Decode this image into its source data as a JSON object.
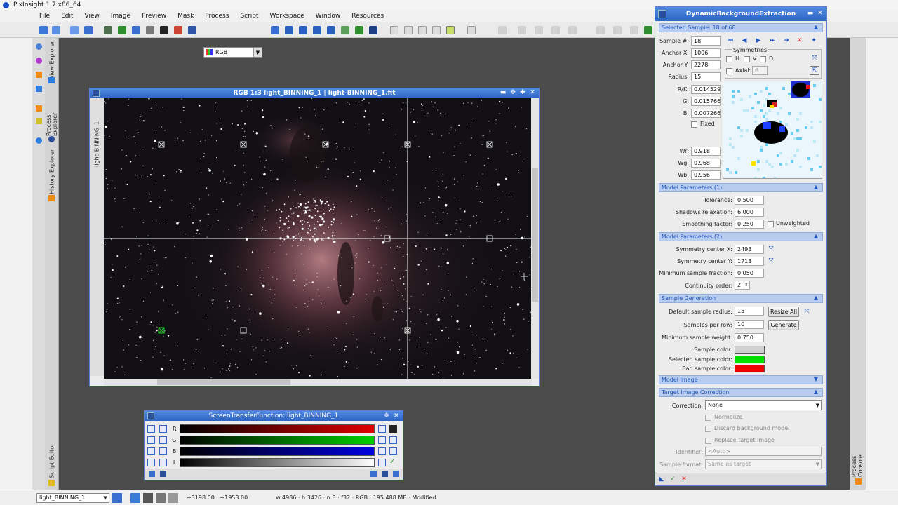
{
  "app": {
    "title": "PixInsight 1.7 x86_64"
  },
  "menu": [
    "File",
    "Edit",
    "View",
    "Image",
    "Preview",
    "Mask",
    "Process",
    "Script",
    "Workspace",
    "Window",
    "Resources"
  ],
  "toolbar": {
    "channel_select": "RGB"
  },
  "left_dock": {
    "tabs": [
      "View Explorer",
      "Process Explorer",
      "History Explorer",
      "Script Editor"
    ]
  },
  "right_dock": {
    "tabs": [
      "Process Console"
    ]
  },
  "image_window": {
    "title": "RGB 1:3 light_BINNING_1 | light-BINNING_1.fit",
    "side_label": "light_BINNING_1"
  },
  "stf": {
    "title": "ScreenTransferFunction: light_BINNING_1",
    "channels": [
      {
        "label": "R:",
        "color": "#e00000"
      },
      {
        "label": "G:",
        "color": "#00d000"
      },
      {
        "label": "B:",
        "color": "#0000e0"
      },
      {
        "label": "L:",
        "color": "#ffffff"
      }
    ]
  },
  "dbe": {
    "title": "DynamicBackgroundExtraction",
    "selected_sample": "Selected Sample: 18 of 68",
    "sample_no_label": "Sample #:",
    "sample_no": "18",
    "anchor_x_label": "Anchor X:",
    "anchor_x": "1006",
    "anchor_y_label": "Anchor Y:",
    "anchor_y": "2278",
    "radius_label": "Radius:",
    "radius": "15",
    "symmetries_label": "Symmetries",
    "sym_h": "H",
    "sym_v": "V",
    "sym_d": "D",
    "axial_label": "Axial:",
    "axial_value": "6",
    "rk_label": "R/K:",
    "rk": "0.014529",
    "g_label": "G:",
    "g": "0.015766",
    "b_label": "B:",
    "b": "0.007266",
    "fixed_label": "Fixed",
    "wr_label": "Wr:",
    "wr": "0.918",
    "wg_label": "Wg:",
    "wg": "0.968",
    "wb_label": "Wb:",
    "wb": "0.956",
    "model1_header": "Model Parameters (1)",
    "tolerance_label": "Tolerance:",
    "tolerance": "0.500",
    "shadows_label": "Shadows relaxation:",
    "shadows": "6.000",
    "smoothing_label": "Smoothing factor:",
    "smoothing": "0.250",
    "unweighted_label": "Unweighted",
    "model2_header": "Model Parameters (2)",
    "symx_label": "Symmetry center X:",
    "symx": "2493",
    "symy_label": "Symmetry center Y:",
    "symy": "1713",
    "minfrac_label": "Minimum sample fraction:",
    "minfrac": "0.050",
    "continuity_label": "Continuity order:",
    "continuity": "2",
    "samplegen_header": "Sample Generation",
    "def_radius_label": "Default sample radius:",
    "def_radius": "15",
    "resize_all": "Resize All",
    "per_row_label": "Samples per row:",
    "per_row": "10",
    "generate": "Generate",
    "min_weight_label": "Minimum sample weight:",
    "min_weight": "0.750",
    "sample_color_label": "Sample color:",
    "sample_color": "#d0d0d0",
    "selected_color_label": "Selected sample color:",
    "selected_color": "#00e000",
    "bad_color_label": "Bad sample color:",
    "bad_color": "#ee0000",
    "model_image_header": "Model Image",
    "target_header": "Target Image Correction",
    "correction_label": "Correction:",
    "correction": "None",
    "normalize_label": "Normalize",
    "discard_label": "Discard background model",
    "replace_label": "Replace target image",
    "identifier_label": "Identifier:",
    "identifier": "<Auto>",
    "format_label": "Sample format:",
    "format": "Same as target"
  },
  "status": {
    "view": "light_BINNING_1",
    "coords": "+3198.00 · +1953.00",
    "info": "w:4986 · h:3426 · n:3 · f32 · RGB · 195.488 MB · Modified"
  }
}
